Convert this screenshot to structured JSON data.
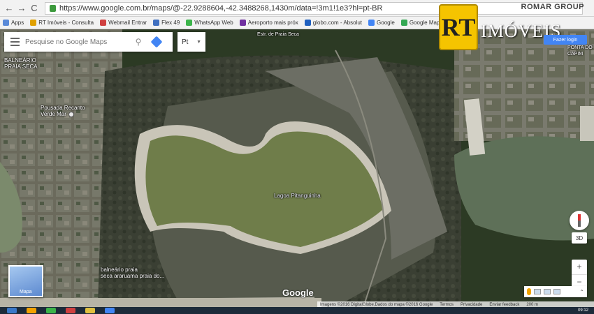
{
  "browser": {
    "url": "https://www.google.com.br/maps/@-22.9288604,-42.3488268,1430m/data=!3m1!1e3?hl=pt-BR",
    "back_glyph": "←",
    "forward_glyph": "→",
    "reload_glyph": "C",
    "star_glyph": "☆",
    "overlay_brand": "ROMAR GROUP"
  },
  "bookmarks": [
    {
      "label": "Apps",
      "color": "#5a8ad8"
    },
    {
      "label": "RT Imóveis - Consulta",
      "color": "#e0a000"
    },
    {
      "label": "Webmail Entrar",
      "color": "#d04040"
    },
    {
      "label": "Flex 49",
      "color": "#4070c0"
    },
    {
      "label": "WhatsApp Web",
      "color": "#3cb44a"
    },
    {
      "label": "Aeroporto mais próx",
      "color": "#7030a0"
    },
    {
      "label": "globo.com - Absolut",
      "color": "#2060c0"
    },
    {
      "label": "Google",
      "color": "#4285f4"
    },
    {
      "label": "Google Maps",
      "color": "#34a853"
    }
  ],
  "search": {
    "placeholder": "Pesquise no Google Maps",
    "lang": "Pt"
  },
  "logo": {
    "mark": "RT",
    "text": "IMÓVEIS"
  },
  "signin_label": "Fazer login",
  "map_labels": {
    "balneario_top": "BALNEÁRIO\nPRAIA SECA",
    "pousada": "Pousada Recanto\nVerde Mar",
    "lagoa": "Lagoa Pitanguinha",
    "estrada": "Estr. de Praia Seca",
    "balneario_bottom": "balneário praia\nseca araruama praia do...",
    "ponta": "PONTA DO\nCAPIM"
  },
  "controls": {
    "tilt": "3D",
    "zoom_in": "+",
    "zoom_out": "−",
    "layer_label": "Mapa",
    "chevron": "⌃"
  },
  "google_text": "Google",
  "attribution": [
    "Imagens ©2016 DigitalGlobe,Dados do mapa ©2016 Google",
    "Termos",
    "Privacidade",
    "Enviar feedback",
    "200 m"
  ],
  "clock": "09:12",
  "colors": {
    "lagoon": "#6f7d4a",
    "forest": "#2c3a24",
    "sand": "#c9c5b8",
    "water": "#5e7058",
    "accent": "#4285f4"
  }
}
